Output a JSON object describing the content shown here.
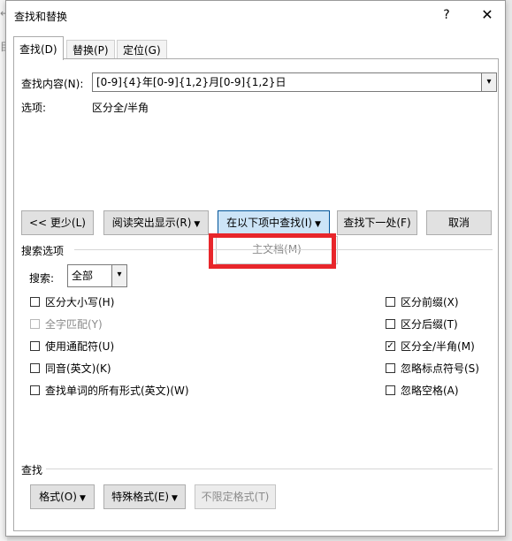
{
  "dialog": {
    "title": "查找和替换",
    "help_glyph": "?",
    "close_glyph": "✕"
  },
  "tabs": [
    {
      "label": "查找(D)",
      "active": true
    },
    {
      "label": "替换(P)",
      "active": false
    },
    {
      "label": "定位(G)",
      "active": false
    }
  ],
  "find": {
    "label": "查找内容(N):",
    "value": "[0-9]{4}年[0-9]{1,2}月[0-9]{1,2}日",
    "options_label": "选项:",
    "options_value": "区分全/半角"
  },
  "buttons": {
    "less": "<< 更少(L)",
    "reading_highlight": "阅读突出显示(R)",
    "find_in": "在以下项中查找(I)",
    "find_next": "查找下一处(F)",
    "cancel": "取消"
  },
  "dropdown": {
    "item": "主文档(M)"
  },
  "search_options": {
    "section_label": "搜索选项",
    "search_label": "搜索:",
    "search_value": "全部"
  },
  "checkboxes_left": [
    {
      "label": "区分大小写(H)",
      "checked": false,
      "enabled": true
    },
    {
      "label": "全字匹配(Y)",
      "checked": false,
      "enabled": false
    },
    {
      "label": "使用通配符(U)",
      "checked": false,
      "enabled": true
    },
    {
      "label": "同音(英文)(K)",
      "checked": false,
      "enabled": true
    },
    {
      "label": "查找单词的所有形式(英文)(W)",
      "checked": false,
      "enabled": true
    }
  ],
  "checkboxes_right": [
    {
      "label": "区分前缀(X)",
      "checked": false,
      "enabled": true
    },
    {
      "label": "区分后缀(T)",
      "checked": false,
      "enabled": true
    },
    {
      "label": "区分全/半角(M)",
      "checked": true,
      "enabled": true
    },
    {
      "label": "忽略标点符号(S)",
      "checked": false,
      "enabled": true
    },
    {
      "label": "忽略空格(A)",
      "checked": false,
      "enabled": true
    }
  ],
  "find_section": {
    "label": "查找",
    "format": "格式(O)",
    "special": "特殊格式(E)",
    "no_format": "不限定格式(T)"
  },
  "background": {
    "glyph_top": "↩",
    "glyph_mid": "目"
  },
  "colors": {
    "highlight_border": "#e8262b",
    "pressed_button": "#cce4f7"
  }
}
